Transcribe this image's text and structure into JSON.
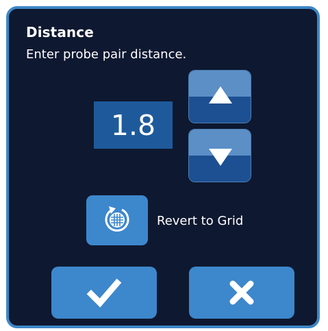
{
  "dialog": {
    "title": "Distance",
    "prompt": "Enter probe pair distance."
  },
  "distance_value": "1.8",
  "stepper": {
    "increase_icon": "triangle-up-icon",
    "decrease_icon": "triangle-down-icon"
  },
  "revert": {
    "icon": "grid-revert-icon",
    "label": "Revert to Grid"
  },
  "actions": {
    "confirm_icon": "checkmark-icon",
    "cancel_icon": "x-icon"
  },
  "colors": {
    "panel_background": "#0e1830",
    "panel_border": "#3d87c6",
    "button": "#3d87cc",
    "value_box": "#1e5a9b"
  }
}
